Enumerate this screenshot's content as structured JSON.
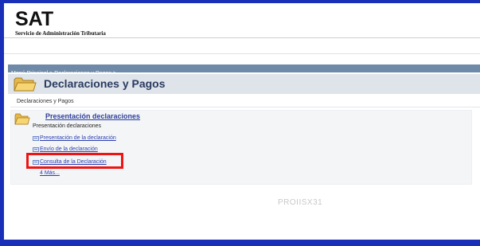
{
  "header": {
    "logo": "SAT",
    "logo_subtitle": "Servicio de Administración Tributaria"
  },
  "breadcrumb": {
    "text": "Menú Principal > Declaraciones y Pagos >"
  },
  "page": {
    "title": "Declaraciones y Pagos",
    "subtitle": "Declaraciones y Pagos"
  },
  "section": {
    "title": "Presentación declaraciones",
    "description": "Presentación declaraciones",
    "links": [
      {
        "label": "Presentación de la declaración"
      },
      {
        "label": "Envío de la declaración"
      },
      {
        "label": "Consulta de la Declaración"
      }
    ],
    "more_label": "4 Más..."
  },
  "footer": {
    "code": "PROIISX31"
  },
  "colors": {
    "frame": "#1a2fb8",
    "breadcrumb_bar": "#6f8aa8",
    "title_bar": "#dfe4ea",
    "link": "#2b3eb0",
    "highlight": "#ef1414"
  },
  "icons": {
    "page_folder": "folder-icon",
    "section_folder": "folder-icon",
    "link_icon": "document-icon"
  }
}
